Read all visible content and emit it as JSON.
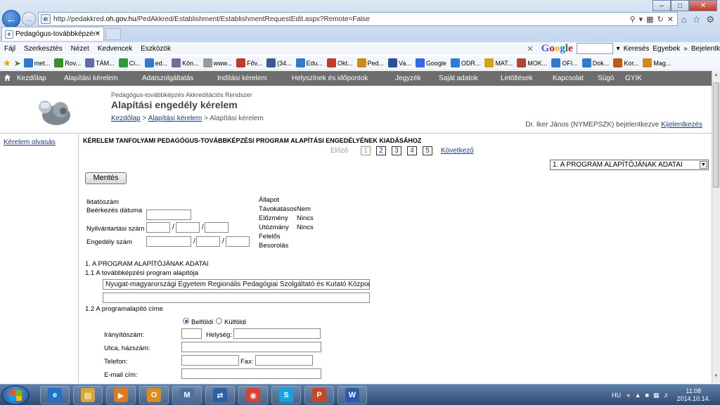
{
  "browser": {
    "url_prefix": "http://pedakkred.",
    "url_host": "oh.gov.hu",
    "url_path": "/PedAkkred/Establishment/EstablishmentRequestEdit.aspx?Remote=False",
    "tab_title": "Pedagógus-továbbképzés Ak...",
    "menu": [
      "Fájl",
      "Szerkesztés",
      "Nézet",
      "Kedvencek",
      "Eszközök"
    ],
    "search_label": "Keresés",
    "more_label": "Egyebek",
    "login_label": "Bejelentk",
    "google_parts": [
      "G",
      "o",
      "o",
      "g",
      "l",
      "e"
    ],
    "favorites": [
      {
        "label": "met...",
        "color": "#2f7bd0"
      },
      {
        "label": "Rov...",
        "color": "#3a8e2a"
      },
      {
        "label": "TÁM...",
        "color": "#5b6fae"
      },
      {
        "label": "Ci...",
        "color": "#2b9b3d"
      },
      {
        "label": "ed...",
        "color": "#2f7bd0"
      },
      {
        "label": "Kön...",
        "color": "#7a6a9a"
      },
      {
        "label": "www...",
        "color": "#9a9a9a"
      },
      {
        "label": "Főv...",
        "color": "#c0392b"
      },
      {
        "label": "(34...",
        "color": "#3b5998"
      },
      {
        "label": "Edu...",
        "color": "#2f7bd0"
      },
      {
        "label": "Okt...",
        "color": "#c0392b"
      },
      {
        "label": "Ped...",
        "color": "#d08a1a"
      },
      {
        "label": "Va...",
        "color": "#2a4fa0"
      },
      {
        "label": "Google",
        "color": "#3369e8"
      },
      {
        "label": "ODR...",
        "color": "#2f7bd0"
      },
      {
        "label": "MAT...",
        "color": "#d7a21a"
      },
      {
        "label": "MOK...",
        "color": "#b0453a"
      },
      {
        "label": "OFI...",
        "color": "#2f7bd0"
      },
      {
        "label": "Dok...",
        "color": "#2f7bd0"
      },
      {
        "label": "Kor...",
        "color": "#c05a1a"
      },
      {
        "label": "Mag...",
        "color": "#d08a1a"
      }
    ]
  },
  "nav": {
    "items": [
      "Kezdőlap",
      "Alapítási kérelem",
      "Adatszolgáltatás",
      "Indítási kérelem",
      "Helyszínek és időpontok",
      "Jegyzék",
      "Saját adatok",
      "Letöltések",
      "Kapcsolat",
      "Súgó",
      "GYIK"
    ]
  },
  "header": {
    "system_name": "Pedagógus-továbbképzés Akkreditációs Rendszer",
    "title": "Alapítási engedély kérelem",
    "breadcrumb": [
      "Kezdőlap",
      "Alapítási kérelem",
      "Alapítási kérelem"
    ],
    "breadcrumb_sep": ">",
    "user_text": "Dr. Iker János (NYMEPSZK) bejelentkezve",
    "logout": "Kijelentkezés"
  },
  "sidebar": {
    "link": "Kérelem olvasás"
  },
  "form": {
    "title": "KÉRELEM TANFOLYAMI PEDAGÓGUS-TOVÁBBKÉPZÉSI PROGRAM ALAPÍTÁSI ENGEDÉLYÉNEK KIADÁSÁHOZ",
    "pager": {
      "prev": "Előző",
      "pages": [
        "1",
        "2",
        "3",
        "4",
        "5"
      ],
      "next": "Következő"
    },
    "section_selected": "1. A PROGRAM ALAPÍTÓJÁNAK ADATAI",
    "save": "Mentés",
    "left_labels": {
      "iktatoszam": "Iktatószám",
      "beerkezes": "Beérkezés dátuma",
      "nyilvantartasi": "Nyilvántartási szám",
      "engedely": "Engedély szám"
    },
    "slash": "/",
    "right_labels": {
      "allapot": "Állapot",
      "tavokatasos": "Távokatásos",
      "tavokatasos_value": "Nem",
      "elozmeny": "Előzmény",
      "elozmeny_value": "Nincs",
      "utozmany": "Utózmány",
      "utozmany_value": "Nincs",
      "felelos": "Felelős",
      "besorolas": "Besorolás"
    },
    "section1": "1. A PROGRAM ALAPÍTÓJÁNAK ADATAI",
    "s11": "1.1 A továbbképzési program alapítója",
    "alapito_value": "Nyugat-magyarországi Egyetem Regionális Pedagógiai Szolgáltató és Kutató Központ",
    "s12": "1.2 A programalapító címe",
    "radio_belfoldi": "Belföldi",
    "radio_kulfoldi": "Külföldi",
    "iranyitoszam": "Irányítószám:",
    "helyseg": "Helység:",
    "utca": "Utca, házszám:",
    "telefon": "Telefon:",
    "fax": "Fax:",
    "email": "E-mail cím:"
  },
  "taskbar": {
    "apps": [
      {
        "name": "ie",
        "glyph": "e",
        "color": "#1f73c9"
      },
      {
        "name": "explorer",
        "glyph": "▤",
        "color": "#d9a734"
      },
      {
        "name": "media",
        "glyph": "▶",
        "color": "#e07a20"
      },
      {
        "name": "outlook",
        "glyph": "O",
        "color": "#e08a1a"
      },
      {
        "name": "marc",
        "glyph": "M",
        "color": "#4a6fa0"
      },
      {
        "name": "sync",
        "glyph": "⇄",
        "color": "#2b5fa8"
      },
      {
        "name": "chrome",
        "glyph": "◉",
        "color": "#d8422e"
      },
      {
        "name": "skype",
        "glyph": "S",
        "color": "#12a5e3"
      },
      {
        "name": "powerpoint",
        "glyph": "P",
        "color": "#c9461f"
      },
      {
        "name": "word",
        "glyph": "W",
        "color": "#2a5caa"
      }
    ],
    "lang": "HU",
    "time": "11:08",
    "date": "2014.10.14."
  }
}
